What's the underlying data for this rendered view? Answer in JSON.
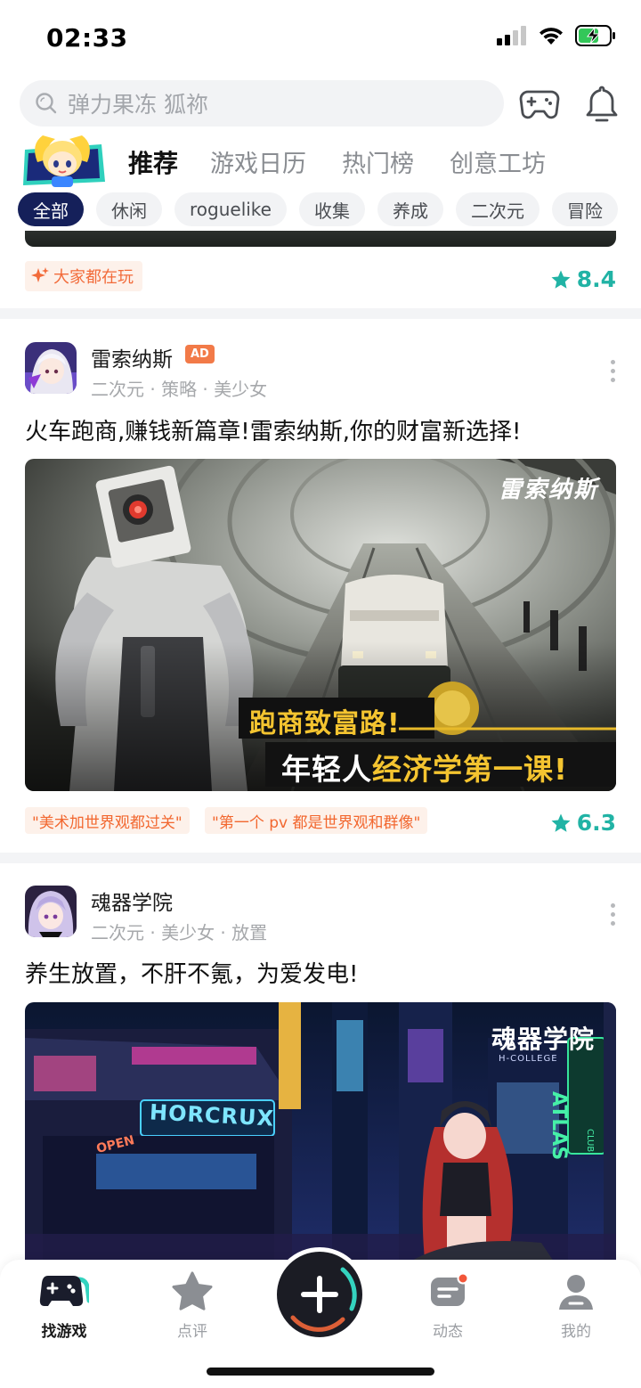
{
  "status_bar": {
    "time": "02:33"
  },
  "search": {
    "placeholder": "弹力果冻 狐祢",
    "icon": "search-icon"
  },
  "header_icons": [
    "gamepad-icon",
    "bell-icon"
  ],
  "top_tabs": [
    {
      "label": "推荐",
      "active": true
    },
    {
      "label": "游戏日历",
      "active": false
    },
    {
      "label": "热门榜",
      "active": false
    },
    {
      "label": "创意工坊",
      "active": false
    }
  ],
  "categories": [
    {
      "label": "全部",
      "active": true
    },
    {
      "label": "休闲"
    },
    {
      "label": "roguelike"
    },
    {
      "label": "收集"
    },
    {
      "label": "养成"
    },
    {
      "label": "二次元"
    },
    {
      "label": "冒险"
    }
  ],
  "feed": {
    "card0": {
      "tag": "大家都在玩",
      "rating": "8.4"
    },
    "card1": {
      "name": "雷索纳斯",
      "ad_badge": "AD",
      "tags": "二次元 · 策略 · 美少女",
      "description": "火车跑商,赚钱新篇章!雷索纳斯,你的财富新选择!",
      "banner_logo": "雷索纳斯",
      "banner_line1": "跑商致富路!",
      "banner_line2_a": "年轻人",
      "banner_line2_b": "经济学第一课!",
      "quotes": [
        "\"美术加世界观都过关\"",
        "\"第一个 pv 都是世界观和群像\""
      ],
      "rating": "6.3"
    },
    "card2": {
      "name": "魂器学院",
      "tags": "二次元 · 美少女 · 放置",
      "description": "养生放置，不肝不氪，为爱发电!",
      "banner_logo": "魂器学院",
      "banner_sub": "H-COLLEGE",
      "sign_horcrux": "HORCRUX",
      "sign_atlas": "ATLAS",
      "sign_club": "CLUB",
      "sign_open": "OPEN"
    }
  },
  "bottom_nav": [
    {
      "label": "找游戏",
      "icon": "gamepad-icon",
      "active": true
    },
    {
      "label": "点评",
      "icon": "star-icon"
    },
    {
      "label": "",
      "icon": "plus-icon"
    },
    {
      "label": "动态",
      "icon": "message-icon"
    },
    {
      "label": "我的",
      "icon": "profile-icon"
    }
  ],
  "colors": {
    "accent": "#34d3bf",
    "chip_active": "#15205a",
    "rating": "#21b3a5",
    "tag_text": "#f26b3a",
    "ad": "#f27a48"
  }
}
